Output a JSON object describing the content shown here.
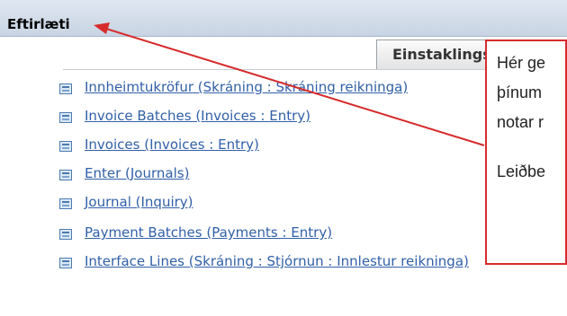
{
  "panel": {
    "title": "Eftirlæti"
  },
  "tab": {
    "label": "Einstaklings"
  },
  "items": [
    {
      "label": "Innheimtukröfur (Skráning : Skráning reikninga)"
    },
    {
      "label": "Invoice Batches (Invoices : Entry)"
    },
    {
      "label": "Invoices (Invoices : Entry)"
    },
    {
      "label": "Enter (Journals)"
    },
    {
      "label": "Journal (Inquiry)"
    },
    {
      "label": "Payment Batches (Payments : Entry)"
    },
    {
      "label": "Interface Lines (Skráning : Stjórnun : Innlestur reikninga)"
    }
  ],
  "callout": {
    "line1": "Hér ge",
    "line2": "þínum",
    "line3": "notar r",
    "line4": "Leiðbe"
  },
  "colors": {
    "link": "#3160a8",
    "callout_border": "#d62c2c",
    "header_bg": "#d0dbe8"
  },
  "icons": {
    "item_icon": "form-icon"
  }
}
